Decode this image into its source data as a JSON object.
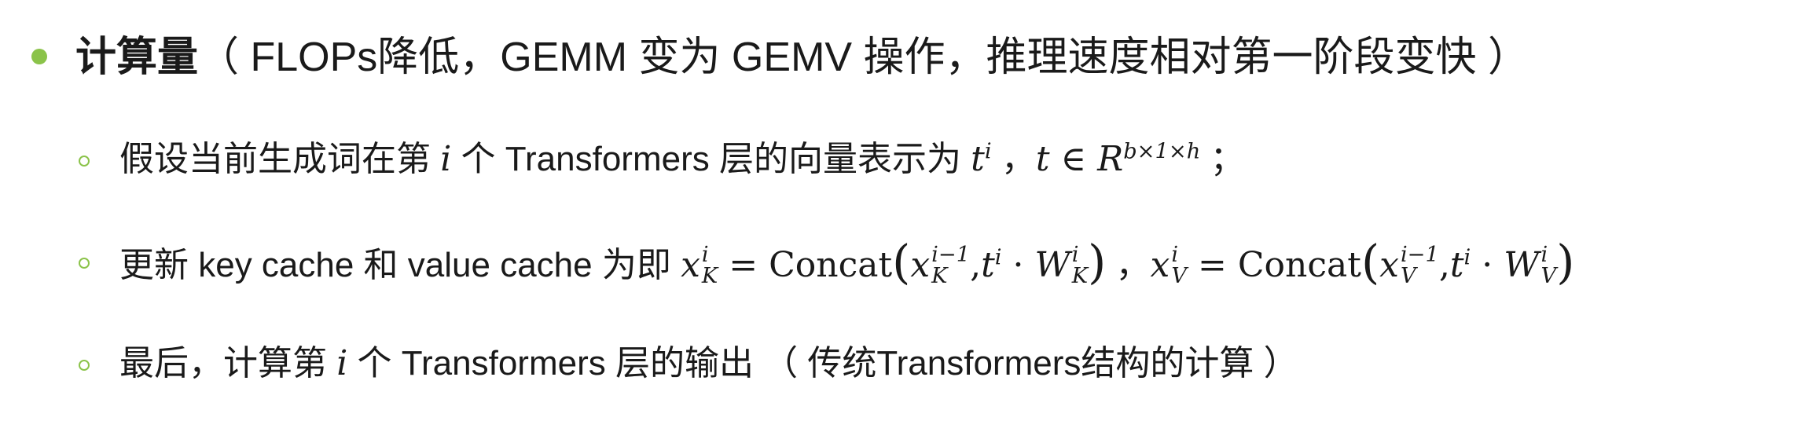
{
  "main_bullet": {
    "heading": "计算量",
    "text": "（ FLOPs降低，GEMM 变为 GEMV 操作，推理速度相对第一阶段变快 ）"
  },
  "sub_bullets": [
    {
      "prefix": "假设当前生成词在第 ",
      "var_i": "i",
      "mid": " 个 Transformers 层的向量表示为 ",
      "t": "t",
      "t_sup": "i",
      "comma": " ，",
      "t2": "t",
      "in": " ∈ ",
      "R": "R",
      "R_sup": "b×1×h",
      "suffix": " ；"
    },
    {
      "prefix": "更新 key cache 和 value cache 为即 ",
      "xK": "x",
      "xK_sup": "i",
      "xK_sub": "K",
      "eq": " = ",
      "concat": "Concat",
      "lp": "(",
      "xK2": "x",
      "xK2_sup": "i−1",
      "xK2_sub": "K",
      "sep": ",",
      "tK": "t",
      "tK_sup": "i",
      "dot": " · ",
      "WK": "W",
      "WK_sup": "i",
      "WK_sub": "K",
      "rp": ")",
      "mid_comma": " ，",
      "xV": "x",
      "xV_sup": "i",
      "xV_sub": "V",
      "eq2": " = ",
      "concat2": "Concat",
      "lp2": "(",
      "xV2": "x",
      "xV2_sup": "i−1",
      "xV2_sub": "V",
      "sep2": ",",
      "tV": "t",
      "tV_sup": "i",
      "dot2": " · ",
      "WV": "W",
      "WV_sup": "i",
      "WV_sub": "V",
      "rp2": ")"
    },
    {
      "prefix": "最后，计算第 ",
      "var_i": "i",
      "suffix": " 个 Transformers 层的输出 （ 传统Transformers结构的计算 ）"
    }
  ],
  "colors": {
    "bullet": "#8bc34a",
    "text": "#1a1a1a"
  }
}
